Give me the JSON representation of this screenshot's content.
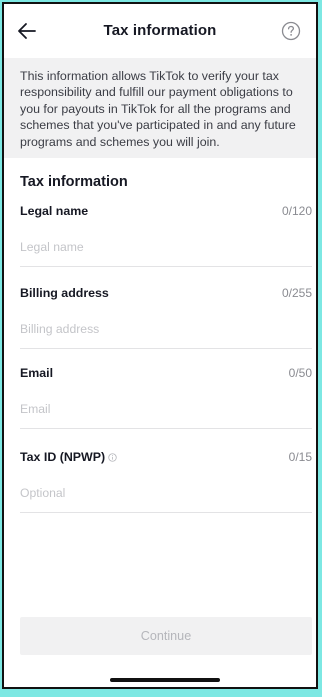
{
  "header": {
    "title": "Tax information",
    "back_icon": "arrow-left-icon",
    "help_icon": "question-circle-icon"
  },
  "info_text": "This information allows TikTok to verify your tax responsibility and fulfill our payment obligations to you for payouts in TikTok for all the programs and schemes that you've participated in and any future programs and schemes you will join.",
  "section_title": "Tax information",
  "fields": [
    {
      "label": "Legal name",
      "counter": "0/120",
      "placeholder": "Legal name",
      "value": ""
    },
    {
      "label": "Billing address",
      "counter": "0/255",
      "placeholder": "Billing address",
      "value": ""
    },
    {
      "label": "Email",
      "counter": "0/50",
      "placeholder": "Email",
      "value": ""
    },
    {
      "label": "Tax ID (NPWP)",
      "counter": "0/15",
      "placeholder": "Optional",
      "value": "",
      "label_icon": "info-icon"
    }
  ],
  "continue_label": "Continue",
  "colors": {
    "background_border": "#7de8e3",
    "info_box_bg": "#f1f1f2",
    "placeholder": "#c4c5c9",
    "counter": "#8a8b91",
    "disabled_button_text": "#b5b6bb"
  }
}
